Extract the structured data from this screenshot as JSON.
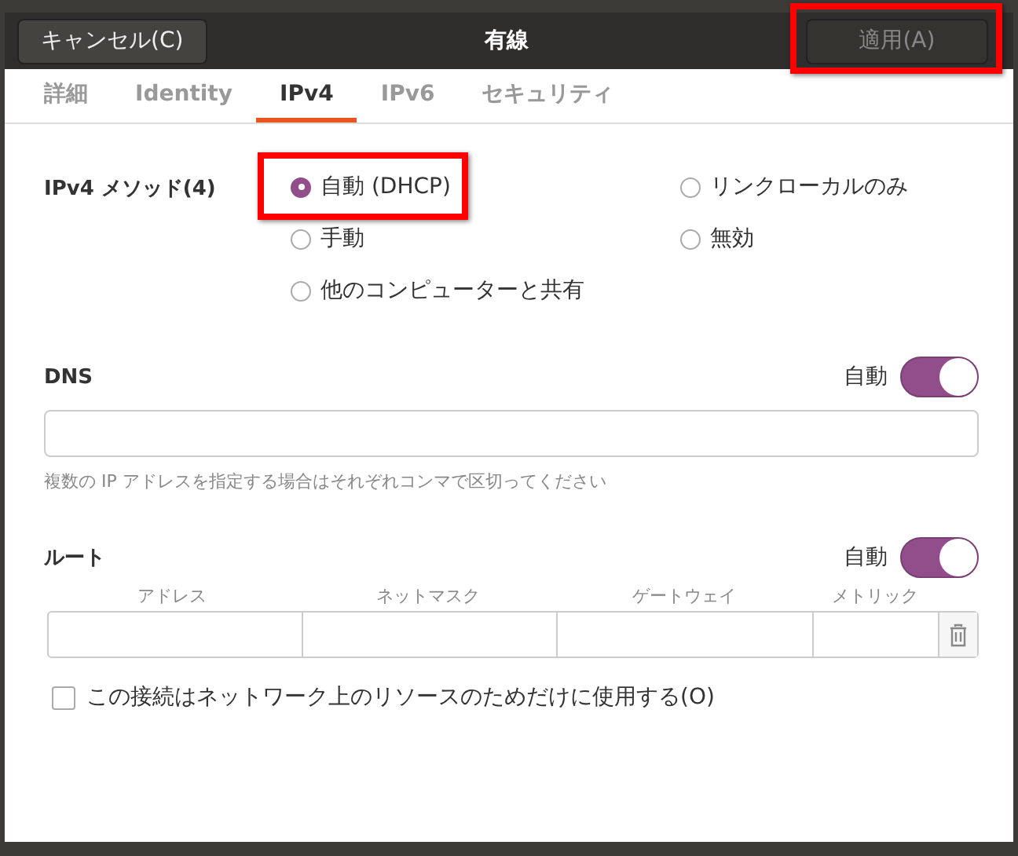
{
  "header": {
    "cancel": "キャンセル(C)",
    "title": "有線",
    "apply": {
      "label": "適用(A)",
      "disabled": true
    }
  },
  "tabs": [
    {
      "label": "詳細",
      "selected": false
    },
    {
      "label": "Identity",
      "selected": false
    },
    {
      "label": "IPv4",
      "selected": true
    },
    {
      "label": "IPv6",
      "selected": false
    },
    {
      "label": "セキュリティ",
      "selected": false
    }
  ],
  "method": {
    "label": "IPv4 メソッド(4)",
    "options": [
      {
        "label": "自動 (DHCP)",
        "selected": true
      },
      {
        "label": "リンクローカルのみ",
        "selected": false
      },
      {
        "label": "手動",
        "selected": false
      },
      {
        "label": "無効",
        "selected": false
      },
      {
        "label": "他のコンピューターと共有",
        "selected": false
      }
    ]
  },
  "dns": {
    "title": "DNS",
    "auto_label": "自動",
    "auto": true,
    "hint": "複数の IP アドレスを指定する場合はそれぞれコンマで区切ってください"
  },
  "routes": {
    "title": "ルート",
    "auto_label": "自動",
    "auto": true,
    "columns": [
      "アドレス",
      "ネットマスク",
      "ゲートウェイ",
      "メトリック"
    ]
  },
  "only_local": {
    "label": "この接続はネットワーク上のリソースのためだけに使用する(O)",
    "checked": false
  }
}
